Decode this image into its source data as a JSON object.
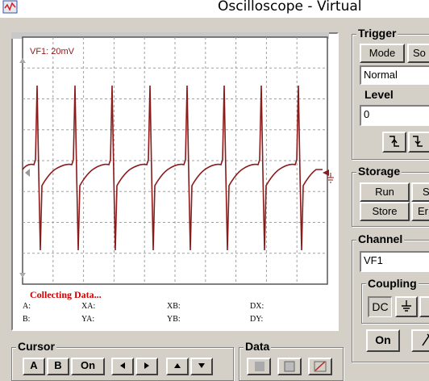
{
  "window": {
    "title": "Oscilloscope - Virtual"
  },
  "screen": {
    "channel_label": "VF1: 20mV",
    "status": "Collecting Data...",
    "trace_color": "#8b1a1a",
    "readouts": {
      "a": "A:",
      "b": "B:",
      "xa": "XA:",
      "ya": "YA:",
      "xb": "XB:",
      "yb": "YB:",
      "dx": "DX:",
      "dy": "DY:"
    }
  },
  "trigger": {
    "title": "Trigger",
    "mode_button": "Mode",
    "source_button": "So",
    "mode_value": "Normal",
    "level_label": "Level",
    "level_value": "0",
    "rising_icon": "rising-edge-icon",
    "falling_icon": "falling-edge-icon"
  },
  "storage": {
    "title": "Storage",
    "run_button": "Run",
    "single_button": "S",
    "store_button": "Store",
    "erase_button": "Er"
  },
  "channel": {
    "title": "Channel",
    "value": "VF1",
    "coupling_title": "Coupling",
    "dc_button": "DC",
    "on_button": "On"
  },
  "cursor": {
    "title": "Cursor",
    "a_button": "A",
    "b_button": "B",
    "on_button": "On"
  },
  "data": {
    "title": "Data"
  }
}
